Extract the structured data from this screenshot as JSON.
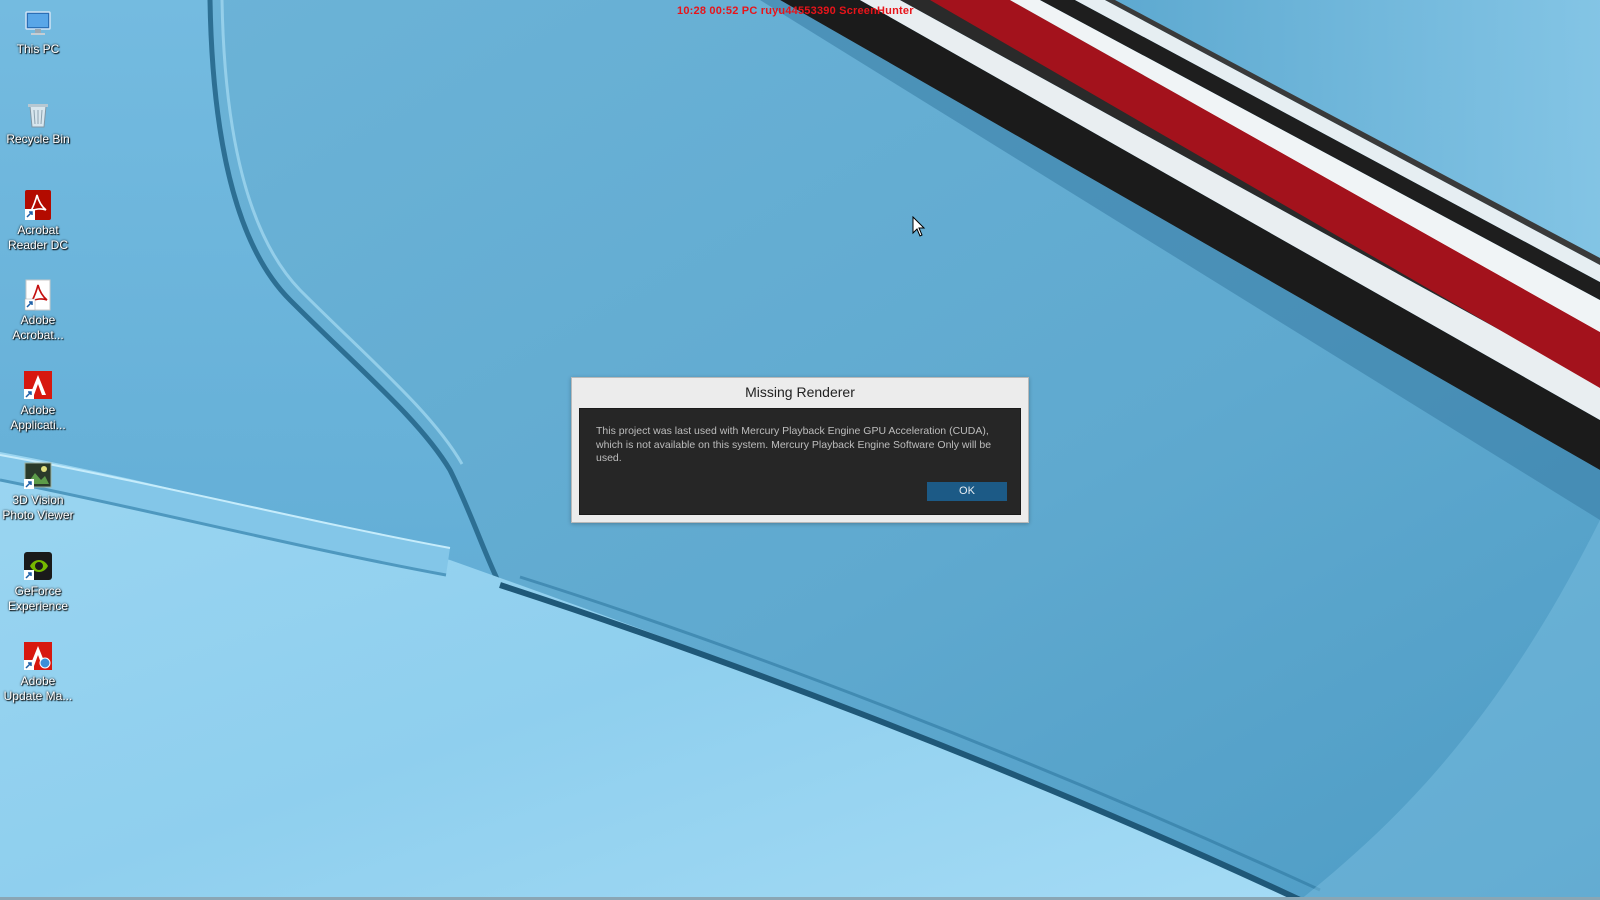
{
  "watermark": {
    "text": "10:28  00:52  PC  ruyu44553390  ScreenHunter",
    "color": "#e8141a"
  },
  "desktop_icons": [
    {
      "label": "This PC",
      "icon": "this-pc-icon"
    },
    {
      "label": "Recycle Bin",
      "icon": "recycle-bin-icon"
    },
    {
      "label": "Acrobat Reader DC",
      "icon": "acrobat-reader-icon"
    },
    {
      "label": "Adobe Acrobat...",
      "icon": "adobe-acrobat-icon"
    },
    {
      "label": "Adobe Applicati...",
      "icon": "adobe-application-manager-icon"
    },
    {
      "label": "3D Vision Photo Viewer",
      "icon": "3d-vision-photo-viewer-icon"
    },
    {
      "label": "GeForce Experience",
      "icon": "geforce-experience-icon"
    },
    {
      "label": "Adobe Update Ma...",
      "icon": "adobe-update-manager-icon"
    }
  ],
  "dialog": {
    "title": "Missing Renderer",
    "message": "This project was last used with Mercury Playback Engine GPU Acceleration (CUDA), which is not available on this system. Mercury Playback Engine Software Only will be used.",
    "ok_label": "OK",
    "accent_color": "#1c5a86"
  },
  "colors": {
    "wallpaper_blue": "#6fb7da",
    "stripe_red": "#a3121c"
  }
}
